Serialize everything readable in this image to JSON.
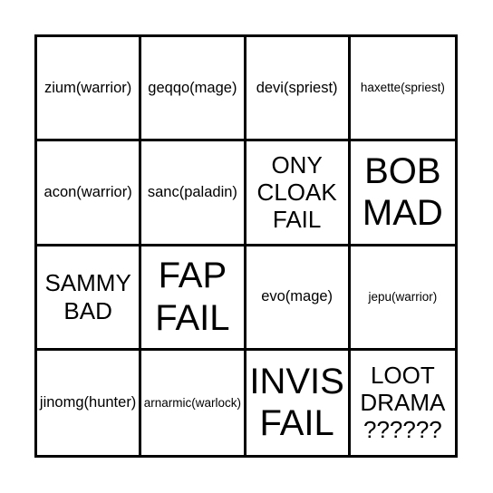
{
  "card": {
    "type": "bingo-card",
    "columns": 4,
    "rows": 4,
    "border_color": "#000000",
    "cell_background": "#ffffff",
    "text_color": "#000000",
    "page_background": "#ffffff",
    "cells": [
      {
        "text": "zium(warrior)",
        "size": "small",
        "lines": 1
      },
      {
        "text": "geqqo(mage)",
        "size": "small",
        "lines": 1
      },
      {
        "text": "devi(spriest)",
        "size": "small",
        "lines": 1
      },
      {
        "text": "haxette(spriest)",
        "size": "xsmall",
        "lines": 1
      },
      {
        "text": "acon(warrior)",
        "size": "small",
        "lines": 1
      },
      {
        "text": "sanc(paladin)",
        "size": "small",
        "lines": 1
      },
      {
        "text": "ONY\nCLOAK\nFAIL",
        "size": "medium",
        "lines": 3
      },
      {
        "text": "BOB\nMAD",
        "size": "large",
        "lines": 2
      },
      {
        "text": "SAMMY\nBAD",
        "size": "medium",
        "lines": 2
      },
      {
        "text": "FAP\nFAIL",
        "size": "large",
        "lines": 2
      },
      {
        "text": "evo(mage)",
        "size": "small",
        "lines": 1
      },
      {
        "text": "jepu(warrior)",
        "size": "xsmall",
        "lines": 1
      },
      {
        "text": "jinomg(hunter)",
        "size": "small",
        "lines": 1
      },
      {
        "text": "arnarmic(warlock)",
        "size": "xsmall",
        "lines": 1
      },
      {
        "text": "INVIS\nFAIL",
        "size": "large",
        "lines": 2
      },
      {
        "text": "LOOT\nDRAMA\n??????",
        "size": "medium",
        "lines": 3
      }
    ]
  }
}
